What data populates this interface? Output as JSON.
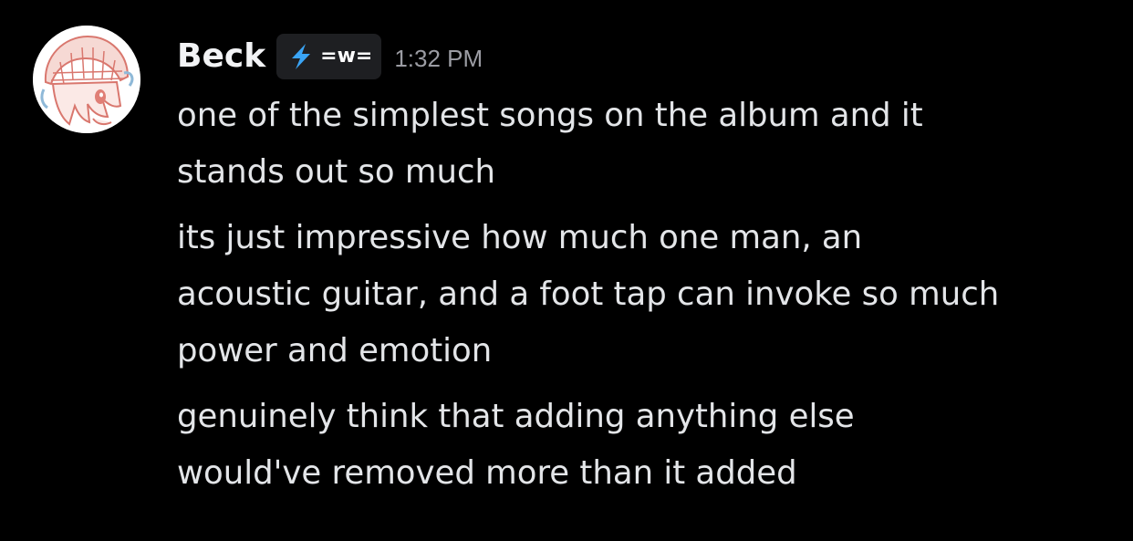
{
  "message": {
    "author": "Beck",
    "tag": {
      "text": "=w=",
      "icon": "lightning-bolt-icon"
    },
    "timestamp": "1:32 PM",
    "paragraphs": [
      {
        "lines": [
          "one of the simplest songs on the album and it",
          "stands out so much"
        ]
      },
      {
        "lines": [
          "its just impressive how much one man, an",
          "acoustic guitar, and a foot tap can invoke so much",
          "power and emotion"
        ]
      },
      {
        "lines": [
          "genuinely think that adding anything else",
          "would've removed more than it added"
        ]
      }
    ]
  },
  "colors": {
    "background": "#000000",
    "username": "#f2f3f5",
    "text": "#e3e5e8",
    "timestamp": "#9b9ca3",
    "tag_background": "#1e1f22",
    "bolt": "#3aa4f5"
  }
}
